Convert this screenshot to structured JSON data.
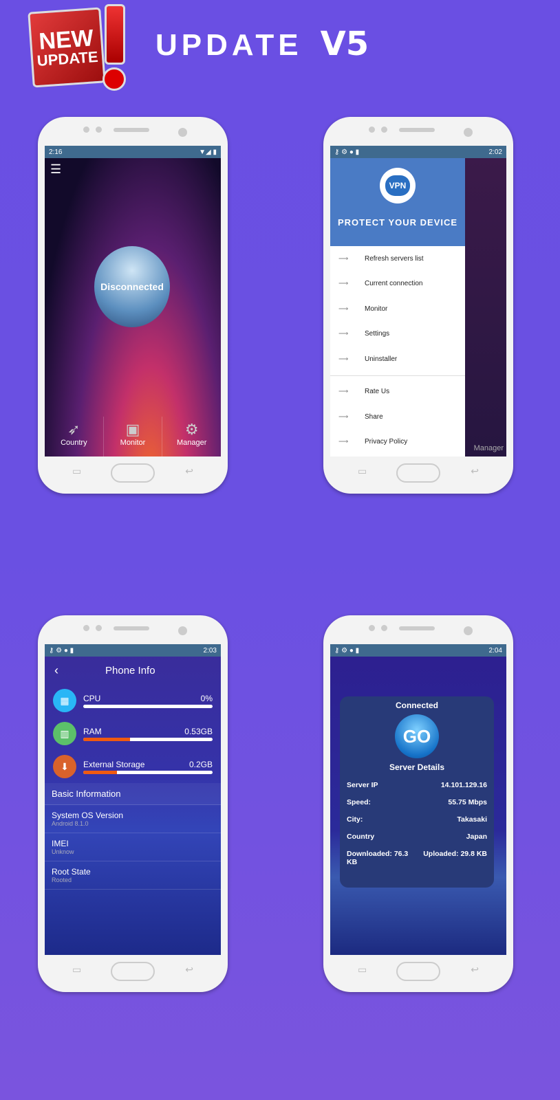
{
  "header": {
    "badge_line1": "NEW",
    "badge_line2": "UPDATE",
    "title": "UPDATE",
    "version": "V5"
  },
  "screen1": {
    "time": "2:16",
    "status": "Disconnected",
    "tabs": [
      {
        "label": "Country",
        "icon": "rocket-icon"
      },
      {
        "label": "Monitor",
        "icon": "chip-icon"
      },
      {
        "label": "Manager",
        "icon": "gear-icon"
      }
    ]
  },
  "screen2": {
    "time": "2:02",
    "logo": "VPN",
    "tagline": "PROTECT YOUR DEVICE",
    "menu": [
      "Refresh servers list",
      "Current connection",
      "Monitor",
      "Settings",
      "Uninstaller"
    ],
    "menu2": [
      "Rate Us",
      "Share",
      "Privacy Policy"
    ],
    "behind_label": "Manager"
  },
  "screen3": {
    "time": "2:03",
    "title": "Phone Info",
    "resources": [
      {
        "label": "CPU",
        "value": "0%",
        "fill": 0,
        "color": "#29b6f6"
      },
      {
        "label": "RAM",
        "value": "0.53GB",
        "fill": 36,
        "color": "#5cc06a"
      },
      {
        "label": "External Storage",
        "value": "0.2GB",
        "fill": 26,
        "color": "#d9622b"
      }
    ],
    "section": "Basic Information",
    "info": [
      {
        "label": "System OS Version",
        "value": "Android 8.1.0"
      },
      {
        "label": "IMEI",
        "value": "Unknow"
      },
      {
        "label": "Root State",
        "value": "Rooted"
      }
    ]
  },
  "screen4": {
    "time": "2:04",
    "status": "Connected",
    "go": "GO",
    "details_title": "Server Details",
    "details": [
      {
        "k": "Server IP",
        "v": "14.101.129.16"
      },
      {
        "k": "Speed:",
        "v": "55.75 Mbps"
      },
      {
        "k": "City:",
        "v": "Takasaki"
      },
      {
        "k": "Country",
        "v": "Japan"
      }
    ],
    "downloaded": "Downloaded: 76.3 KB",
    "uploaded": "Uploaded: 29.8 KB"
  }
}
